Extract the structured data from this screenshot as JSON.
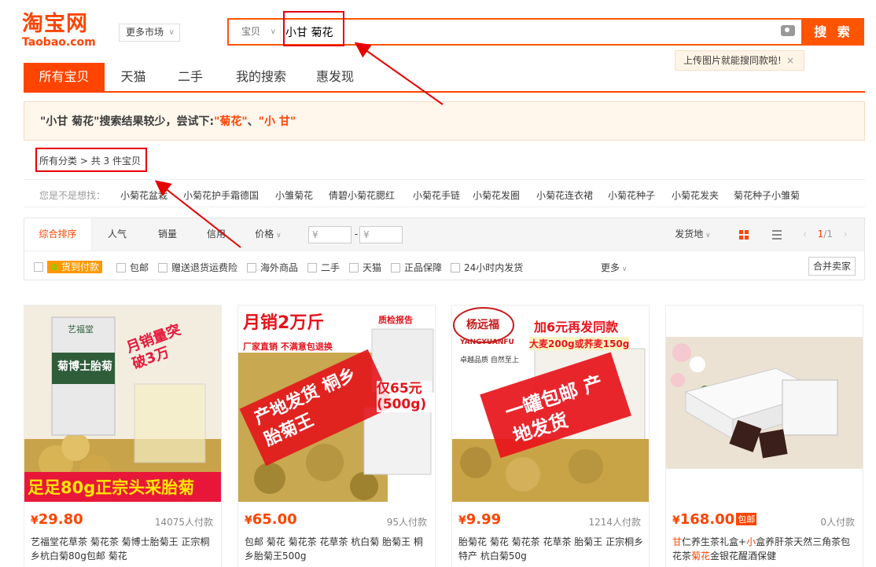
{
  "logo": {
    "cn": "淘宝网",
    "en": "Taobao.com"
  },
  "market_label": "更多市场",
  "search": {
    "type_label": "宝贝",
    "query": "小甘 菊花",
    "button_label": "搜 索",
    "tooltip": "上传图片就能搜同款啦!",
    "tooltip_close": "×"
  },
  "nav_tabs": [
    "所有宝贝",
    "天猫",
    "二手",
    "我的搜索",
    "惠发现"
  ],
  "suggestion": {
    "prefix": "\"小甘 菊花\"搜索结果较少，尝试下:",
    "link1": "\"菊花\"",
    "sep": "、",
    "link2": "\"小 甘\""
  },
  "breadcrumb": {
    "root": "所有分类",
    "count": "共 3 件宝贝"
  },
  "maybe": {
    "label": "您是不是想找：",
    "items": [
      "小菊花盆栽",
      "小菊花护手霜德国",
      "小雏菊花",
      "倩碧小菊花腮红",
      "小菊花手链",
      "小菊花发圈",
      "小菊花连衣裙",
      "小菊花种子",
      "小菊花发夹",
      "菊花种子小雏菊"
    ]
  },
  "sort": {
    "items": [
      "综合排序",
      "人气",
      "销量",
      "信用",
      "价格"
    ],
    "price_placeholder": "¥",
    "dash": "-",
    "ship_from": "发货地",
    "pager_current": "1",
    "pager_total": "/1"
  },
  "filters": {
    "cod": "货到付款",
    "items": [
      "包邮",
      "赠送退货运费险",
      "海外商品",
      "二手",
      "天猫",
      "正品保障",
      "24小时内发货"
    ],
    "more": "更多",
    "merge": "合并卖家"
  },
  "products": [
    {
      "price_symbol": "¥",
      "price": "29.80",
      "sales": "14075人付款",
      "title": "艺福堂花草茶 菊花茶 菊博士胎菊王 正宗桐乡杭白菊80g包邮 菊花",
      "overlay_top": "月销量突破3万",
      "overlay_bottom": "足足80g正宗头采胎菊",
      "can_label": "菊博士胎菊",
      "brand": "艺福堂"
    },
    {
      "price_symbol": "¥",
      "price": "65.00",
      "sales": "95人付款",
      "title": "包邮 菊花 菊花茶 花草茶 杭白菊 胎菊王 桐乡胎菊王500g",
      "overlay_top": "月销2万斤",
      "overlay_sub": "厂家直销 不满意包退换",
      "overlay_stamp": "产地发货 桐乡胎菊王",
      "overlay_price": "仅65元 (500g)",
      "overlay_report": "质检报告"
    },
    {
      "price_symbol": "¥",
      "price": "9.99",
      "sales": "1214人付款",
      "title": "胎菊花 菊花 菊花茶 花草茶 胎菊王 正宗桐乡特产 杭白菊50g",
      "overlay_brand": "杨远福",
      "overlay_brand_en": "YANGYUANFU",
      "overlay_top": "加6元再发同款",
      "overlay_sub": "大麦200g或荞麦150g",
      "overlay_stamp": "一罐包邮 产地发货",
      "overlay_slogan": "卓越品质 自然至上"
    },
    {
      "price_symbol": "¥",
      "price": "168.00",
      "baoyou": "包邮",
      "sales": "0人付款",
      "title_parts": [
        {
          "t": "甘",
          "hl": true
        },
        {
          "t": "仁养生茶礼盒+",
          "hl": false
        },
        {
          "t": "小",
          "hl": true
        },
        {
          "t": "盒养肝茶天然三角茶包花茶",
          "hl": false
        },
        {
          "t": "菊花",
          "hl": true
        },
        {
          "t": "金银花醒酒保健",
          "hl": false
        }
      ]
    }
  ],
  "colors": {
    "accent": "#ff4400",
    "annotation": "#e60000"
  }
}
